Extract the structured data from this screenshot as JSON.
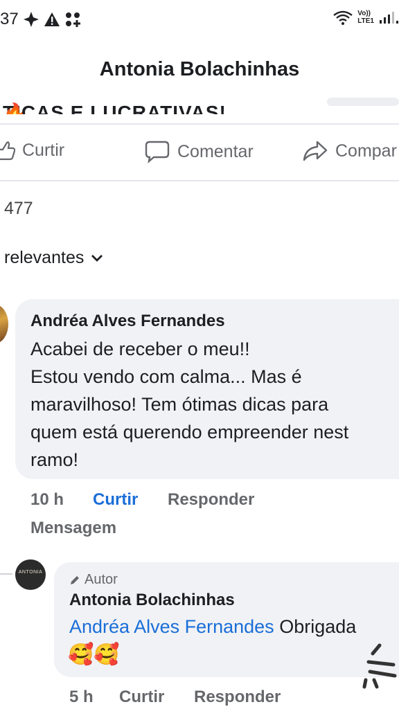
{
  "status_bar": {
    "time_fragment": "37",
    "volte_top": "Vo))",
    "volte_bottom": "LTE1",
    "signal_icon": "signal-bars-icon",
    "wifi_icon": "wifi-icon"
  },
  "header": {
    "title": "Antonia Bolachinhas"
  },
  "post": {
    "clipped_text": "TICAS E LUCRATIVAS!",
    "fire_emoji": "🔥"
  },
  "actions": {
    "like_label": "Curtir",
    "comment_label": "Comentar",
    "share_label": "Compar"
  },
  "reactions": {
    "count": "477"
  },
  "sort": {
    "label": "relevantes"
  },
  "comments": [
    {
      "author": "Andréa Alves Fernandes",
      "lines": [
        "Acabei de receber o meu!!",
        "Estou vendo com calma... Mas é",
        "maravilhoso! Tem ótimas dicas para",
        "quem está querendo empreender nest",
        "ramo!"
      ],
      "time": "10 h",
      "like_label": "Curtir",
      "reply_label": "Responder",
      "message_label": "Mensagem"
    }
  ],
  "reply": {
    "badge": "Autor",
    "author": "Antonia Bolachinhas",
    "avatar_text": "ANTONIA",
    "mention": "Andréa Alves Fernandes",
    "text": "Obrigada",
    "emojis": "🥰🥰",
    "time": "5 h",
    "like_label": "Curtir",
    "reply_label": "Responder"
  },
  "colors": {
    "link_blue": "#1a6ed8",
    "bubble_gray": "#f0f2f5",
    "meta_gray": "#65676b"
  }
}
